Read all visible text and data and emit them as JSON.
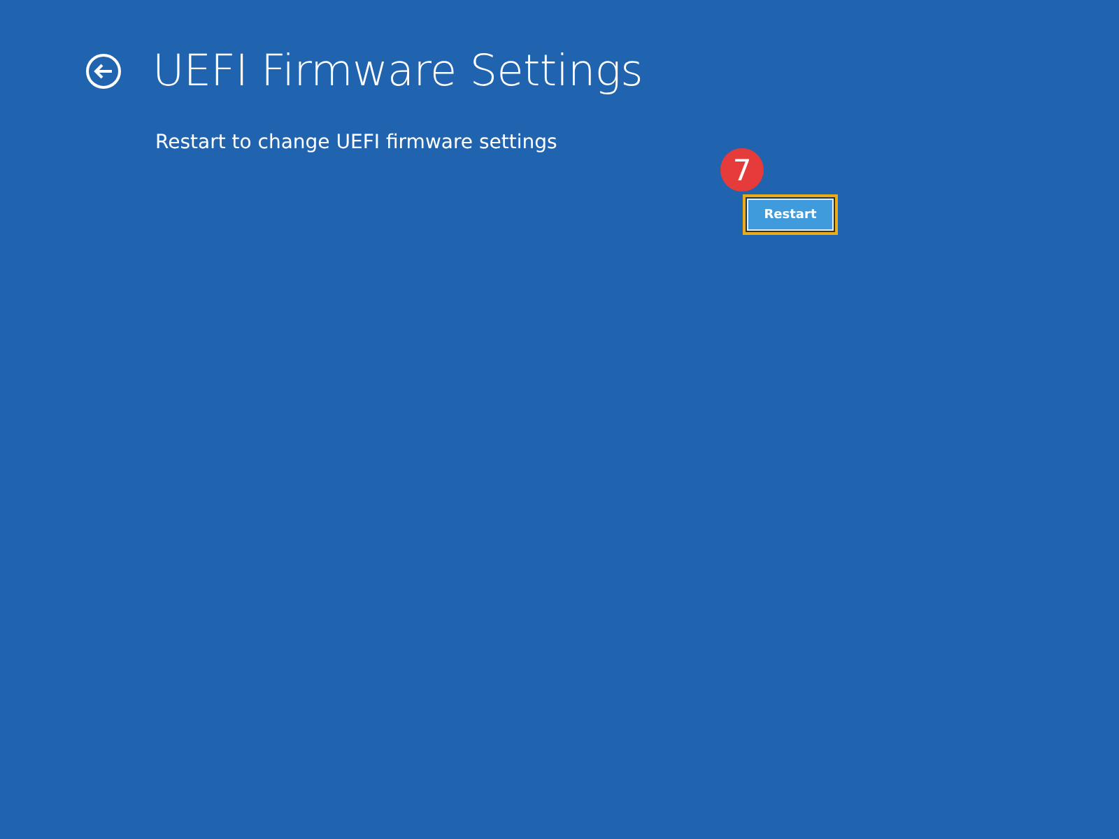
{
  "title": "UEFI Firmware Settings",
  "description": "Restart to change UEFI firmware settings",
  "button": {
    "label": "Restart",
    "highlighted": true
  },
  "step_badge": {
    "label": "7"
  }
}
